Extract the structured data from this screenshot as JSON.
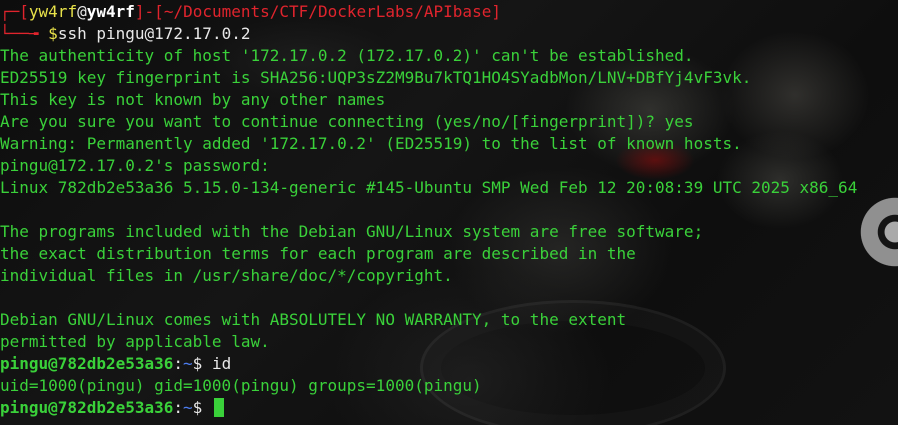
{
  "prompt1": {
    "corner_top": "┌─",
    "bracket_open": "[",
    "user": "yw4rf",
    "at": "@",
    "host": "yw4rf",
    "bracket_close": "]",
    "sep": "-",
    "path_open": "[",
    "path": "~/Documents/CTF/DockerLabs/APIbase",
    "path_close": "]",
    "corner_bottom": "└──╼ ",
    "dollar": "$",
    "command": "ssh pingu@172.17.0.2"
  },
  "ssh_output": [
    "The authenticity of host '172.17.0.2 (172.17.0.2)' can't be established.",
    "ED25519 key fingerprint is SHA256:UQP3sZ2M9Bu7kTQ1HO4SYadbMon/LNV+DBfYj4vF3vk.",
    "This key is not known by any other names",
    "Are you sure you want to continue connecting (yes/no/[fingerprint])? yes",
    "Warning: Permanently added '172.17.0.2' (ED25519) to the list of known hosts.",
    "pingu@172.17.0.2's password:",
    "Linux 782db2e53a36 5.15.0-134-generic #145-Ubuntu SMP Wed Feb 12 20:08:39 UTC 2025 x86_64",
    "",
    "The programs included with the Debian GNU/Linux system are free software;",
    "the exact distribution terms for each program are described in the",
    "individual files in /usr/share/doc/*/copyright.",
    "",
    "Debian GNU/Linux comes with ABSOLUTELY NO WARRANTY, to the extent",
    "permitted by applicable law."
  ],
  "prompt2": {
    "userhost": "pingu@782db2e53a36",
    "colon": ":",
    "path": "~",
    "dollar": "$ ",
    "command": "id"
  },
  "id_output": "uid=1000(pingu) gid=1000(pingu) groups=1000(pingu)",
  "prompt3": {
    "userhost": "pingu@782db2e53a36",
    "colon": ":",
    "path": "~",
    "dollar": "$ "
  },
  "colors": {
    "prompt_red": "#e0242d",
    "output_green": "#3ad13a",
    "path_blue": "#4d7ef2",
    "user_yellow": "#e8e24a"
  }
}
